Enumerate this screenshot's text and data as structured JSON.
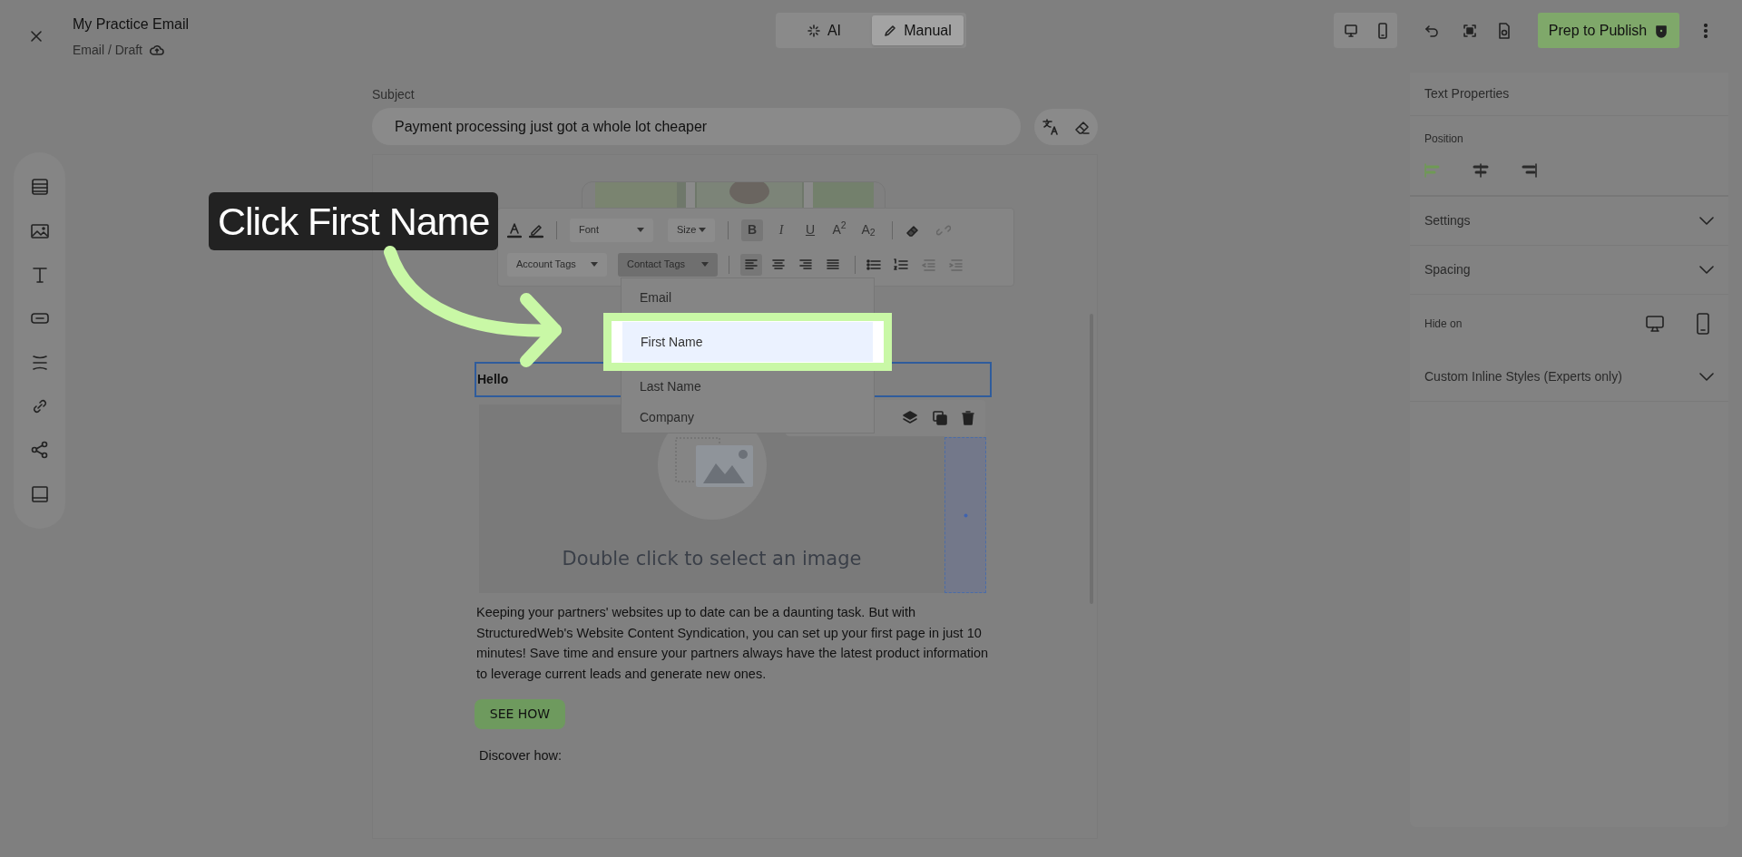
{
  "header": {
    "title": "My Practice Email",
    "breadcrumb": "Email / Draft"
  },
  "mode_tabs": [
    {
      "label": "AI",
      "kind": "ai",
      "selected": false
    },
    {
      "label": "Manual",
      "kind": "manual",
      "selected": true
    }
  ],
  "publish_button": "Prep to Publish",
  "subject": {
    "label": "Subject",
    "value": "Payment processing just got a whole lot cheaper"
  },
  "toolbar": {
    "font": "Font",
    "size": "Size",
    "account_tags": "Account Tags",
    "contact_tags": "Contact Tags",
    "format_buttons": [
      {
        "kind": "bold",
        "label": "B",
        "selected": true
      },
      {
        "kind": "italic",
        "label": "I",
        "selected": false
      },
      {
        "kind": "underline",
        "label": "U",
        "selected": false
      },
      {
        "kind": "superscript",
        "label": "A$^{2}$",
        "selected": false
      },
      {
        "kind": "subscript",
        "label": "A$_{2}$",
        "selected": false
      }
    ],
    "align_buttons": [
      {
        "kind": "left",
        "selected": true
      },
      {
        "kind": "center",
        "selected": false
      },
      {
        "kind": "right",
        "selected": false
      },
      {
        "kind": "justify",
        "selected": false
      }
    ]
  },
  "contact_tags_menu": [
    {
      "label": "Email",
      "selected": false
    },
    {
      "label": "First Name",
      "selected": true
    },
    {
      "label": "Last Name",
      "selected": false
    },
    {
      "label": "Company",
      "selected": false
    }
  ],
  "email": {
    "greeting": "Hello",
    "image_placeholder": "Double click to select an image",
    "paragraph": "Keeping your partners' websites up to date can be a daunting task. But with StructuredWeb's Website Content Syndication, you can set up your first page in just 10 minutes! Save time and ensure your partners always have the latest product information to leverage current leads and generate new ones.",
    "button": "SEE HOW",
    "footer_text": "Discover how:"
  },
  "properties": {
    "title": "Text Properties",
    "position_label": "Position",
    "positions": [
      {
        "kind": "left",
        "selected": true
      },
      {
        "kind": "center",
        "selected": false
      },
      {
        "kind": "right",
        "selected": false
      }
    ],
    "sections": [
      {
        "label": "Settings",
        "kind": "collapsible",
        "expanded": false
      },
      {
        "label": "Spacing",
        "kind": "collapsible",
        "expanded": false
      },
      {
        "label": "Hide on",
        "kind": "devices"
      },
      {
        "label": "Custom Inline Styles (Experts only)",
        "kind": "collapsible",
        "expanded": false
      }
    ]
  },
  "callout": {
    "text": "Click First Name"
  }
}
